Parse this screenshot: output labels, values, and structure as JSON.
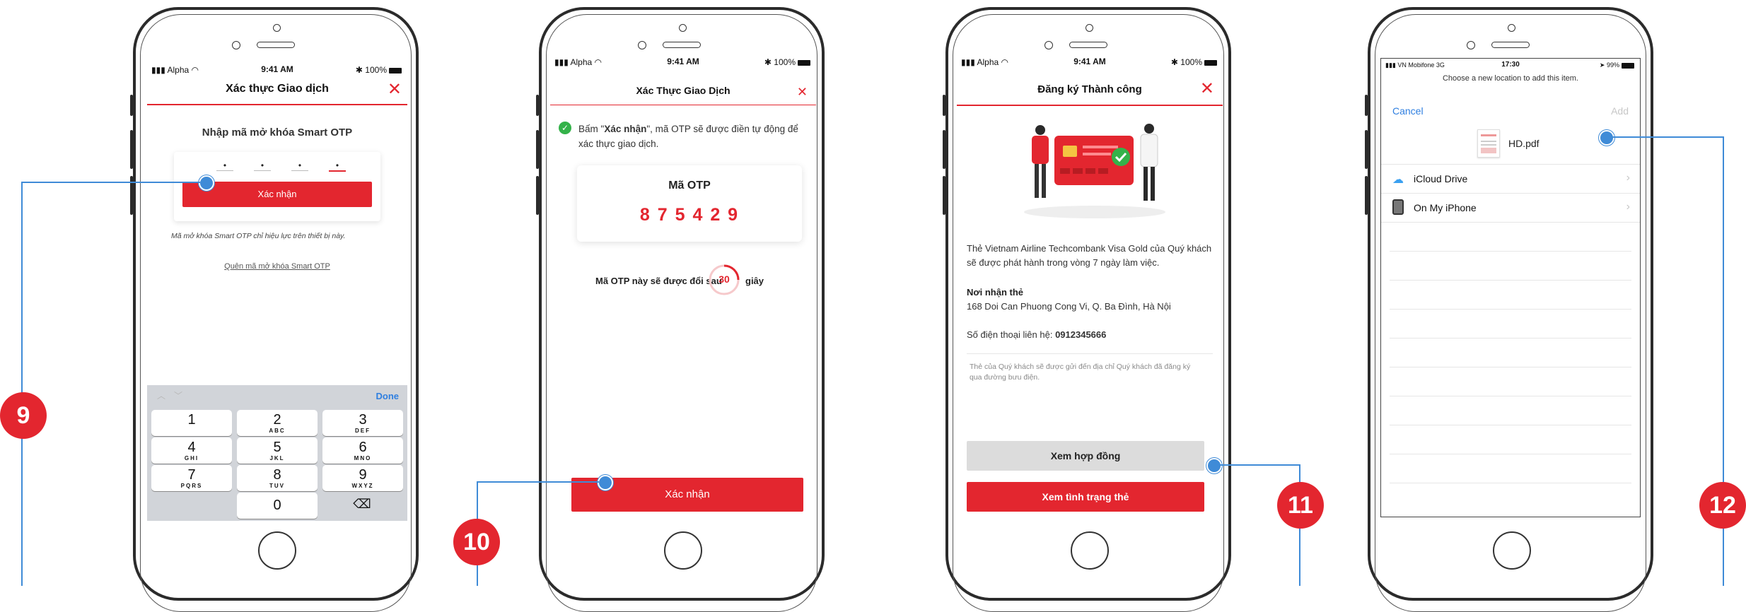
{
  "colors": {
    "brand_red": "#e3262f",
    "callout_blue": "#3f8bd7",
    "keypad_bg": "#d1d4d9"
  },
  "callouts": [
    "9",
    "10",
    "11",
    "12"
  ],
  "screen1": {
    "status": {
      "carrier": "Alpha",
      "time": "9:41 AM",
      "battery": "100%"
    },
    "title": "Xác thực Giao dịch",
    "heading": "Nhập mã mở khóa Smart OTP",
    "pin_dots": [
      "•",
      "•",
      "•",
      "•"
    ],
    "confirm": "Xác nhận",
    "note": "Mã mở khóa Smart OTP chỉ hiệu lực trên thiết bị này.",
    "forgot": "Quên mã mở khóa Smart OTP",
    "keyboard": {
      "done": "Done",
      "keys": [
        {
          "d": "1",
          "s": ""
        },
        {
          "d": "2",
          "s": "ABC"
        },
        {
          "d": "3",
          "s": "DEF"
        },
        {
          "d": "4",
          "s": "GHI"
        },
        {
          "d": "5",
          "s": "JKL"
        },
        {
          "d": "6",
          "s": "MNO"
        },
        {
          "d": "7",
          "s": "PQRS"
        },
        {
          "d": "8",
          "s": "TUV"
        },
        {
          "d": "9",
          "s": "WXYZ"
        }
      ],
      "zero": "0",
      "delete_icon": "⌫"
    }
  },
  "screen2": {
    "status": {
      "carrier": "Alpha",
      "time": "9:41 AM",
      "battery": "100%"
    },
    "title": "Xác Thực Giao Dịch",
    "info_pre": "Bấm \"",
    "info_bold": "Xác nhận",
    "info_post": "\", mã OTP sẽ được điền tự động để xác thực giao dịch.",
    "otp_label": "Mã OTP",
    "otp_code": "8 7 5 4 2 9",
    "timer_pre": "Mã OTP này sẽ được đổi sau",
    "timer_value": "30",
    "timer_post": "giây",
    "timer_progress": 0.25,
    "confirm": "Xác nhận"
  },
  "screen3": {
    "status": {
      "carrier": "Alpha",
      "time": "9:41 AM",
      "battery": "100%"
    },
    "title": "Đăng ký Thành công",
    "message": "Thẻ Vietnam Airline Techcombank Visa Gold của Quý khách sẽ được phát hành trong vòng 7 ngày làm việc.",
    "receive_label": "Nơi nhận thẻ",
    "receive_address": "168 Doi Can Phuong Cong Vi, Q. Ba Đình, Hà Nội",
    "phone_label": "Số điện thoại liên hệ:",
    "phone_value": "0912345666",
    "note": "Thẻ của Quý khách sẽ được gửi đến địa chỉ Quý khách đã đăng ký qua đường bưu điện.",
    "btn_contract": "Xem hợp đồng",
    "btn_status": "Xem tình trạng thẻ"
  },
  "screen4": {
    "status": {
      "carrier": "VN Mobifone",
      "network": "3G",
      "time": "17:30",
      "battery": "99%"
    },
    "prompt": "Choose a new location to add this item.",
    "cancel": "Cancel",
    "add": "Add",
    "file_name": "HD.pdf",
    "locations": [
      {
        "label": "iCloud Drive",
        "icon": "cloud-icon"
      },
      {
        "label": "On My iPhone",
        "icon": "iphone-icon"
      }
    ]
  }
}
